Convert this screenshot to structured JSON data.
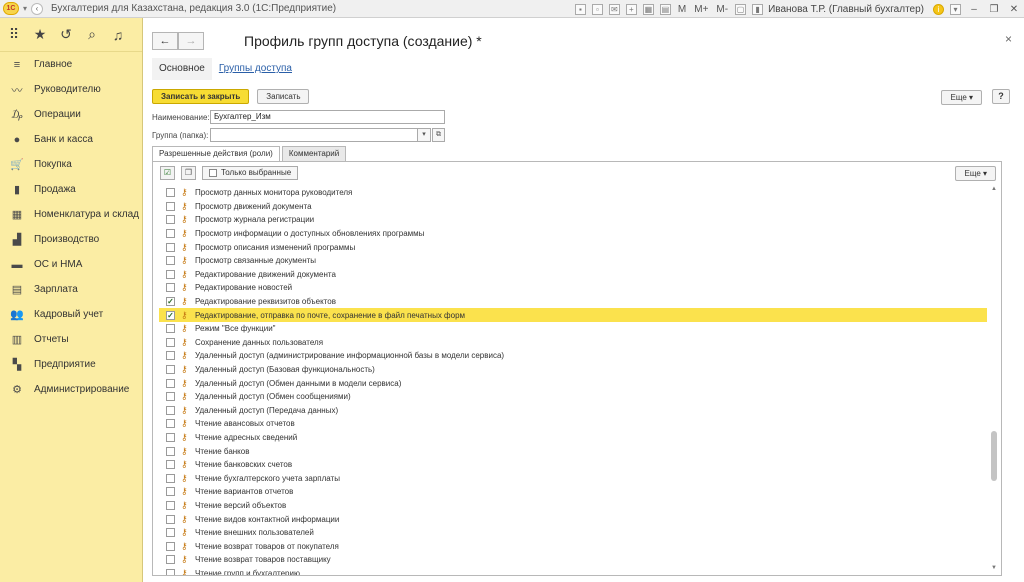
{
  "titlebar": {
    "logo": "1С",
    "title": "Бухгалтерия для Казахстана, редакция 3.0  (1С:Предприятие)",
    "m_label": "M",
    "mplus_label": "M+",
    "mminus_label": "M-",
    "user": "Иванова Т.Р. (Главный бухгалтер)",
    "min": "–",
    "restore": "❐",
    "close": "✕"
  },
  "sidebar": {
    "items": [
      {
        "label": "Главное",
        "icon": "≡"
      },
      {
        "label": "Руководителю",
        "icon": "〰"
      },
      {
        "label": "Операции",
        "icon": "₯"
      },
      {
        "label": "Банк и касса",
        "icon": "●"
      },
      {
        "label": "Покупка",
        "icon": "🛒"
      },
      {
        "label": "Продажа",
        "icon": "▮"
      },
      {
        "label": "Номенклатура и склад",
        "icon": "▦"
      },
      {
        "label": "Производство",
        "icon": "▟"
      },
      {
        "label": "ОС и НМА",
        "icon": "▬"
      },
      {
        "label": "Зарплата",
        "icon": "▤"
      },
      {
        "label": "Кадровый учет",
        "icon": "👥"
      },
      {
        "label": "Отчеты",
        "icon": "▥"
      },
      {
        "label": "Предприятие",
        "icon": "▚"
      },
      {
        "label": "Администрирование",
        "icon": "⚙"
      }
    ]
  },
  "form": {
    "back": "←",
    "forward": "→",
    "title": "Профиль групп доступа (создание) *",
    "close": "×",
    "tabs": [
      "Основное",
      "Группы доступа"
    ],
    "save_close": "Записать и закрыть",
    "save": "Записать",
    "more": "Еще ▾",
    "help": "?",
    "name_label": "Наименование:",
    "name_value": "Бухгалтер_Изм",
    "group_label": "Группа (папка):",
    "group_value": "",
    "inner_tabs": [
      "Разрешенные действия (роли)",
      "Комментарий"
    ],
    "only_selected": "Только выбранные",
    "panel_more": "Еще ▾"
  },
  "roles": [
    {
      "label": "Просмотр данных монитора руководителя",
      "checked": false
    },
    {
      "label": "Просмотр движений документа",
      "checked": false
    },
    {
      "label": "Просмотр журнала регистрации",
      "checked": false
    },
    {
      "label": "Просмотр информации о доступных обновлениях программы",
      "checked": false
    },
    {
      "label": "Просмотр описания изменений программы",
      "checked": false
    },
    {
      "label": "Просмотр связанные документы",
      "checked": false
    },
    {
      "label": "Редактирование движений документа",
      "checked": false
    },
    {
      "label": "Редактирование новостей",
      "checked": false
    },
    {
      "label": "Редактирование реквизитов объектов",
      "checked": true
    },
    {
      "label": "Редактирование, отправка по почте, сохранение в файл печатных форм",
      "checked": true,
      "selected": true
    },
    {
      "label": "Режим \"Все функции\"",
      "checked": false
    },
    {
      "label": "Сохранение данных пользователя",
      "checked": false
    },
    {
      "label": "Удаленный доступ (администрирование информационной базы в модели сервиса)",
      "checked": false
    },
    {
      "label": "Удаленный доступ (Базовая функциональность)",
      "checked": false
    },
    {
      "label": "Удаленный доступ (Обмен данными в модели сервиса)",
      "checked": false
    },
    {
      "label": "Удаленный доступ (Обмен сообщениями)",
      "checked": false
    },
    {
      "label": "Удаленный доступ (Передача данных)",
      "checked": false
    },
    {
      "label": "Чтение авансовых отчетов",
      "checked": false
    },
    {
      "label": "Чтение адресных сведений",
      "checked": false
    },
    {
      "label": "Чтение банков",
      "checked": false
    },
    {
      "label": "Чтение банковских счетов",
      "checked": false
    },
    {
      "label": "Чтение бухгалтерского учета зарплаты",
      "checked": false
    },
    {
      "label": "Чтение вариантов отчетов",
      "checked": false
    },
    {
      "label": "Чтение версий объектов",
      "checked": false
    },
    {
      "label": "Чтение видов контактной информации",
      "checked": false
    },
    {
      "label": "Чтение внешних пользователей",
      "checked": false
    },
    {
      "label": "Чтение возврат товаров от покупателя",
      "checked": false
    },
    {
      "label": "Чтение возврат товаров поставщику",
      "checked": false
    },
    {
      "label": "Чтение групп и бухгалтерию",
      "checked": false
    }
  ],
  "colors": {
    "sidebar_bg": "#fbeda4",
    "accent": "#f7dc33",
    "link": "#2a5fa8",
    "selected_row": "#fbe24d"
  }
}
